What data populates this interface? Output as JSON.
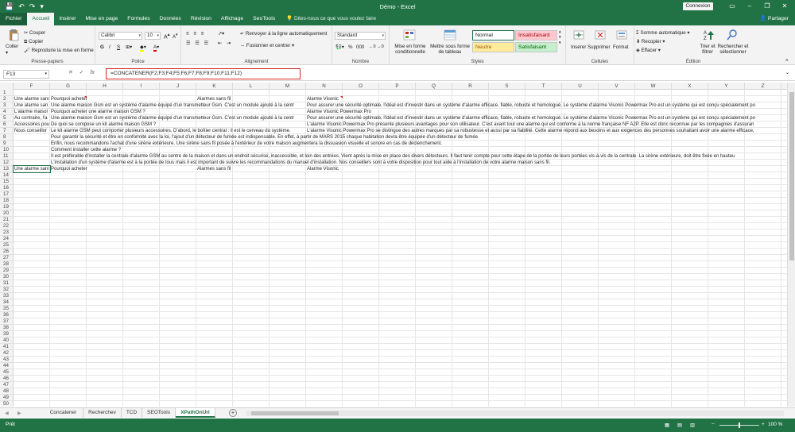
{
  "window": {
    "title": "Démo - Excel",
    "signin_label": "Connexion",
    "minimize_glyph": "–",
    "restore_glyph": "❐",
    "close_glyph": "✕"
  },
  "quick_access": {
    "save_glyph": "💾",
    "undo_glyph": "↶",
    "redo_glyph": "↷",
    "customize_glyph": "▾"
  },
  "ribbon_tabs": [
    {
      "label": "Fichier"
    },
    {
      "label": "Accueil"
    },
    {
      "label": "Insérer"
    },
    {
      "label": "Mise en page"
    },
    {
      "label": "Formules"
    },
    {
      "label": "Données"
    },
    {
      "label": "Révision"
    },
    {
      "label": "Affichage"
    },
    {
      "label": "SeoTools"
    }
  ],
  "tell_me": "Dites-nous ce que vous voulez faire",
  "share_label": "Partager",
  "ribbon": {
    "clipboard": {
      "paste": "Coller",
      "cut": "Couper",
      "copy": "Copier",
      "format_painter": "Reproduire la mise en forme",
      "label": "Presse-papiers"
    },
    "font": {
      "name": "Calibri",
      "size": "10",
      "bold": "G",
      "italic": "I",
      "underline": "S",
      "label": "Police"
    },
    "alignment": {
      "wrap": "Renvoyer à la ligne automatiquement",
      "merge": "Fusionner et centrer",
      "label": "Alignement"
    },
    "number": {
      "format": "Standard",
      "pct": "%",
      "thousands": "000",
      "label": "Nombre"
    },
    "styles": {
      "conditional": "Mise en forme conditionnelle",
      "as_table": "Mettre sous forme de tableau",
      "normal": "Normal",
      "insufficient": "Insatisfaisant",
      "neutral": "Neutre",
      "satisfying": "Satisfaisant",
      "label": "Styles"
    },
    "cells": {
      "insert": "Insérer",
      "delete": "Supprimer",
      "format": "Format",
      "label": "Cellules"
    },
    "editing": {
      "autosum": "Somme automatique",
      "fill": "Recopier",
      "clear": "Effacer",
      "sort": "Trier et filtrer",
      "find": "Rechercher et sélectionner",
      "label": "Édition"
    }
  },
  "formula_bar": {
    "name_box": "F13",
    "cancel_glyph": "✕",
    "enter_glyph": "✓",
    "fx_label": "fx",
    "formula": "=CONCATENER(F2;F3;F4;F5;F6;F7;F8;F9;F10;F11;F12)"
  },
  "columns": [
    "F",
    "G",
    "H",
    "I",
    "J",
    "K",
    "L",
    "M",
    "N",
    "O",
    "P",
    "Q",
    "R",
    "S",
    "T",
    "U",
    "V",
    "W",
    "X",
    "Y",
    "Z"
  ],
  "rows": [
    "1",
    "2",
    "3",
    "4",
    "5",
    "6",
    "7",
    "8",
    "9",
    "10",
    "11",
    "12",
    "13",
    "14",
    "15",
    "16",
    "17",
    "18",
    "19",
    "20",
    "21",
    "22",
    "23",
    "24",
    "25",
    "26",
    "27",
    "28",
    "29",
    "30",
    "31",
    "32",
    "33",
    "34",
    "35",
    "36",
    "37",
    "38",
    "39",
    "40",
    "41",
    "42",
    "43",
    "44",
    "45",
    "46",
    "47",
    "48",
    "49",
    "50"
  ],
  "cells": {
    "F2": "Une alarme sans",
    "G2": "Pourquoi acheter",
    "K2": "Alarmes sans fil",
    "N2": "Alarme Visonic",
    "F3": "Une alarme san",
    "G3": "Une alarme maison Gsm est un système d'alarme équipé d'un transmetteur Gsm. C'est un module ajouté à la centr",
    "N3": "Pour assurer une sécurité optimale, l'idéal est d'investir dans un système d'alarme efficace, fiable, robuste et homologué. Le système d'alarme Visonic Powermax Pro est un système qui est conçu spécialement po",
    "F4": "L'alarme maisol",
    "G4": "Pourquoi acheter une alarme maison GSM ?",
    "N4": "Alarme Visonic Powermax Pro",
    "F5": "Au contraire, l'a",
    "G5": "Une alarme maison Gsm est un système d'alarme équipé d'un transmetteur Gsm. C'est un module ajouté à la centr",
    "N5": "Pour assurer une sécurité optimale, l'idéal est d'investir dans un système d'alarme efficace, fiable, robuste et homologué. Le système d'alarme Visonic Powermax Pro est un système qui est conçu spécialement po",
    "F6": "Accessoires pou",
    "G6": "De quoi se compose un kit alarme maison GSM ?",
    "N6": "L'alarme Visonic Powermax Pro présente plusieurs avantages pour son utilisateur. C'est avant tout une alarme qui est conforme à la norme française NF A2P. Elle est donc reconnue par les compagnies d'assuran",
    "F7": "Nous conseillor",
    "G7": "Le kit alarme GSM peut comporter plusieurs accessoires. D'abord, le boîtier central : il est le cerveau du système.",
    "N7": "L'alarme Visonic Powermax Pro se distingue des autres marques par sa robustesse et aussi par sa fiabilité. Cette alarme répond aux besoins et aux exigences des personnes souhaitant avoir une alarme efficace,",
    "G8": "Pour garantir la sécurité et être en conformité avec la loi, l'ajout d'un détecteur de fumée est indispensable. En effet, à partir de MARS 2015 chaque habitation devra être équipée d'un détecteur de fumée.",
    "G9": "Enfin, nous recommandons l'achat d'une sirène extérieure. Une sirène sans fil posée à l'extérieur de votre maison augmentera la dissuasion visuelle et sonore en cas de déclenchement.",
    "G10": "Comment installer cette alarme ?",
    "G11": "Il est préférable d'installer la centrale d'alarme GSM au centre de la maison et dans un endroit sécurisé, inaccessible, et loin des entrées. Vient après la mise en place des divers détecteurs. Il faut tenir compte pour cette étape de la portée de leurs portées vis-à-vis de la centrale. La sirène extérieure, doit être fixée en hauteu",
    "G12": "L'installation d'un système d'alarme est à la portée de tous mais il est important de suivre les recommandations du manuel d'installation. Nos conseillers sont à votre disposition pour tout aide à l'installation de votre alarme maison sans fil.",
    "F13": "Une alarme sans",
    "G13": "Pourquoi acheter",
    "K13": "Alarmes sans fil",
    "N13": "Alarme Visonic"
  },
  "sheets": [
    {
      "label": "Concatener"
    },
    {
      "label": "Recherchev"
    },
    {
      "label": "TCD"
    },
    {
      "label": "SEOTools"
    },
    {
      "label": "XPathOnUrl"
    }
  ],
  "add_sheet_glyph": "+",
  "status": {
    "mode": "Prêt",
    "zoom": "100 %",
    "zoom_minus": "−",
    "zoom_plus": "+"
  },
  "colors": {
    "excel_green": "#217346",
    "selection": "#217346",
    "formula_highlight": "#d6261f"
  }
}
